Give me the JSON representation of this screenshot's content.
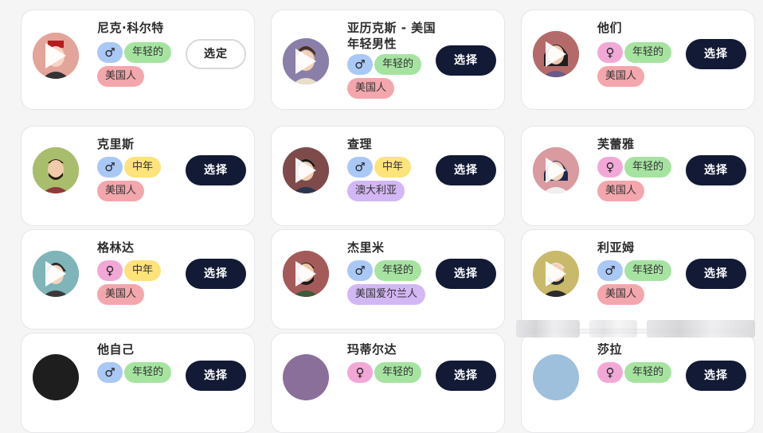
{
  "cards": [
    {
      "name": "尼克·科尔特",
      "sex": "♂",
      "age": "年轻的",
      "nation": "美国人",
      "button": "选定",
      "selected": true
    },
    {
      "name": "亚历克斯 - 美国年轻男性",
      "sex": "♂",
      "age": "年轻的",
      "nation": "美国人",
      "button": "选择",
      "selected": false
    },
    {
      "name": "他们",
      "sex": "♀",
      "age": "年轻的",
      "nation": "美国人",
      "button": "选择",
      "selected": false
    },
    {
      "name": "克里斯",
      "sex": "♂",
      "age": "中年",
      "nation": "美国人",
      "button": "选择",
      "selected": false
    },
    {
      "name": "查理",
      "sex": "♂",
      "age": "中年",
      "nation": "澳大利亚",
      "button": "选择",
      "selected": false
    },
    {
      "name": "芙蕾雅",
      "sex": "♀",
      "age": "年轻的",
      "nation": "美国人",
      "button": "选择",
      "selected": false
    },
    {
      "name": "格林达",
      "sex": "♀",
      "age": "中年",
      "nation": "美国人",
      "button": "选择",
      "selected": false
    },
    {
      "name": "杰里米",
      "sex": "♂",
      "age": "年轻的",
      "nation": "美国爱尔兰人",
      "button": "选择",
      "selected": false
    },
    {
      "name": "利亚姆",
      "sex": "♂",
      "age": "年轻的",
      "nation": "美国人",
      "button": "选择",
      "selected": false
    },
    {
      "name": "他自己",
      "sex": "♂",
      "age": "年轻的",
      "nation": "",
      "button": "选择",
      "selected": false
    },
    {
      "name": "玛蒂尔达",
      "sex": "♀",
      "age": "年轻的",
      "nation": "",
      "button": "选择",
      "selected": false
    },
    {
      "name": "莎拉",
      "sex": "♀",
      "age": "年轻的",
      "nation": "",
      "button": "选择",
      "selected": false
    }
  ],
  "colors": {
    "button_dark": "#121a35",
    "male": "#a9c8f5",
    "female": "#f2a8d6",
    "young": "#a6e3a1",
    "middle": "#fce37a",
    "american": "#f4a6ad",
    "other_nation": "#d3b6f4"
  }
}
